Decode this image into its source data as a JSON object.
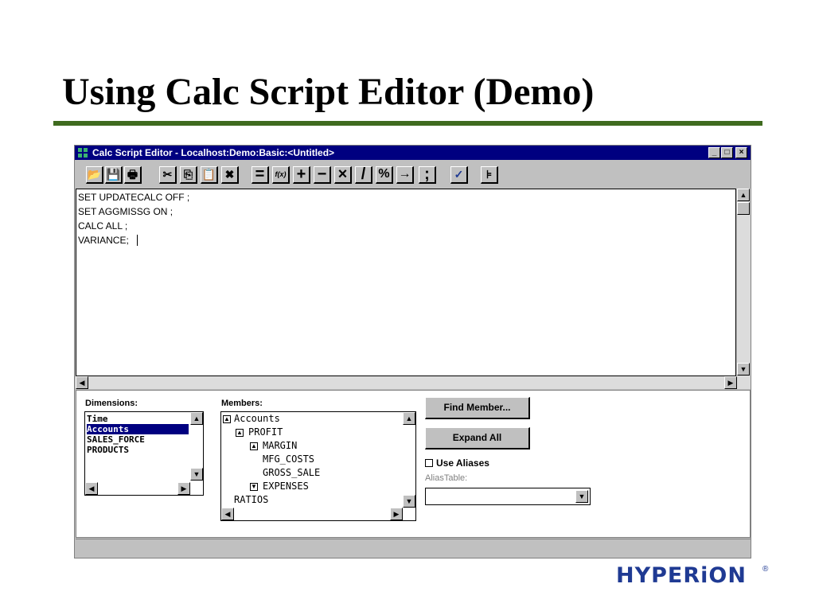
{
  "slide": {
    "title": "Using Calc Script Editor (Demo)"
  },
  "window": {
    "title": "Calc Script Editor - Localhost:Demo:Basic:<Untitled>",
    "controls": {
      "minimize": "_",
      "maximize": "□",
      "close": "×"
    }
  },
  "toolbar": {
    "buttons": [
      {
        "name": "open-icon",
        "glyph": "📂"
      },
      {
        "name": "save-icon",
        "glyph": "💾"
      },
      {
        "name": "print-icon",
        "glyph": "🖶"
      },
      {
        "name": "cut-icon",
        "glyph": "✂"
      },
      {
        "name": "copy-icon",
        "glyph": "⎘"
      },
      {
        "name": "paste-icon",
        "glyph": "📋"
      },
      {
        "name": "clear-icon",
        "glyph": "✖"
      },
      {
        "name": "equals-operator",
        "glyph": "="
      },
      {
        "name": "function-icon",
        "glyph": "f(x)"
      },
      {
        "name": "plus-operator",
        "glyph": "+"
      },
      {
        "name": "minus-operator",
        "glyph": "−"
      },
      {
        "name": "multiply-operator",
        "glyph": "×"
      },
      {
        "name": "divide-operator",
        "glyph": "/"
      },
      {
        "name": "percent-operator",
        "glyph": "%"
      },
      {
        "name": "arrow-operator",
        "glyph": "→"
      },
      {
        "name": "semicolon-operator",
        "glyph": ";"
      },
      {
        "name": "check-syntax-icon",
        "glyph": "✓"
      },
      {
        "name": "member-icon",
        "glyph": "⊧"
      }
    ]
  },
  "editor": {
    "lines": [
      "SET UPDATECALC OFF ;",
      "SET AGGMISSG ON ;",
      "CALC ALL ;",
      "VARIANCE;"
    ]
  },
  "dimensions": {
    "label": "Dimensions:",
    "items": [
      "Time",
      "Accounts",
      "SALES_FORCE",
      "PRODUCTS"
    ],
    "selected": "Accounts"
  },
  "members": {
    "label": "Members:",
    "items": [
      {
        "label": "Accounts",
        "toggle": "expanded"
      },
      {
        "label": "PROFIT",
        "toggle": "expanded"
      },
      {
        "label": "MARGIN",
        "toggle": "expanded"
      },
      {
        "label": "MFG_COSTS",
        "toggle": ""
      },
      {
        "label": "GROSS_SALE",
        "toggle": ""
      },
      {
        "label": "EXPENSES",
        "toggle": "collapsed"
      },
      {
        "label": "RATIOS",
        "toggle": ""
      }
    ]
  },
  "actions": {
    "find_member": "Find Member...",
    "expand_all": "Expand All",
    "use_aliases": "Use Aliases",
    "use_aliases_checked": false,
    "alias_table_label": "AliasTable:",
    "alias_table_value": ""
  },
  "logo": {
    "text": "HYPERiON",
    "reg": "®"
  }
}
